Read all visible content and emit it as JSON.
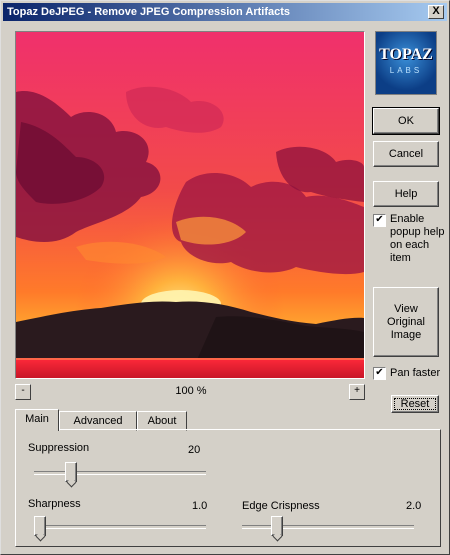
{
  "window": {
    "title": "Topaz DeJPEG - Remove JPEG Compression Artifacts",
    "close_label": "X"
  },
  "logo": {
    "line1": "TOPAZ",
    "line2": "LABS"
  },
  "buttons": {
    "ok": "OK",
    "cancel": "Cancel",
    "help": "Help",
    "view_original": "View Original Image",
    "reset": "Reset"
  },
  "checkboxes": {
    "popup_help": {
      "label": "Enable popup help on each item",
      "checked": true
    },
    "pan_faster": {
      "label": "Pan faster",
      "checked": true
    }
  },
  "zoom": {
    "minus": "-",
    "plus": "+",
    "value": "100 %"
  },
  "tabs": [
    "Main",
    "Advanced",
    "About"
  ],
  "active_tab": "Main",
  "sliders": {
    "suppression": {
      "label": "Suppression",
      "value": "20",
      "fraction": 0.2
    },
    "sharpness": {
      "label": "Sharpness",
      "value": "1.0",
      "fraction": 0.0
    },
    "edge_crispness": {
      "label": "Edge Crispness",
      "value": "2.0",
      "fraction": 0.2
    }
  },
  "colors": {
    "titlebar_start": "#0a246a",
    "titlebar_end": "#a6caf0",
    "face": "#d4d0c8",
    "accent_sky": "#e8204a"
  }
}
